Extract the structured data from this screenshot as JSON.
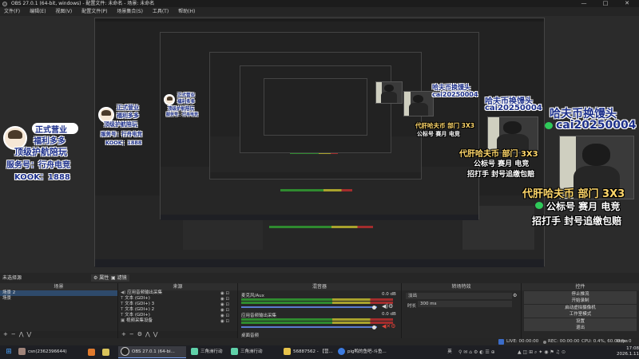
{
  "window": {
    "title": "OBS 27.0.1 (64-bit, windows) - 配置文件: 未命名 - 场景: 未命名",
    "controls": [
      "—",
      "□",
      "✕"
    ]
  },
  "menu": [
    "文件(F)",
    "编辑(E)",
    "视图(V)",
    "配置文件(P)",
    "场景集合(S)",
    "工具(T)",
    "帮助(H)"
  ],
  "overlay": {
    "large": {
      "line1": "哈夫币换馒头",
      "line2": "cai20250004",
      "line3": "代肝哈夫币 部门 3X3",
      "line4": "公标号 赛月 电竞",
      "line5": "招打手 封号追缴包赔"
    },
    "left_badge": {
      "line1": "正式营业",
      "line2": "福利多多",
      "line3": "顶级护航陪玩",
      "line4": "服务号：行舟电竞",
      "line5": "KOOK：1888"
    }
  },
  "dock_header": {
    "left": "未选择源",
    "prop_button": "属性",
    "filter_button": "滤镜"
  },
  "scenes": {
    "title": "场景",
    "items": [
      "场景 2",
      "场景"
    ]
  },
  "sources": {
    "title": "来源",
    "items": [
      "应用音频输出采集",
      "文本 (GDI+)",
      "文本 (GDI+) 3",
      "文本 (GDI+) 2",
      "文本 (GDI+)",
      "视频采集设备"
    ]
  },
  "mixer": {
    "title": "混音器",
    "ch1": {
      "name": "麦克风/Aux",
      "db": "0.0 dB"
    },
    "ch2": {
      "name": "应用音频输出采集",
      "db": "0.0 dB"
    },
    "ch3": {
      "name": "桌面音频"
    }
  },
  "transitions": {
    "title": "转场特效",
    "type": "淡出",
    "duration_label": "时长",
    "duration_value": "300 ms"
  },
  "controls": {
    "title": "控件",
    "buttons": [
      "停止推流",
      "开始录制",
      "启动虚拟摄像机",
      "工作室模式",
      "设置",
      "退出"
    ]
  },
  "status": {
    "live": "LIVE: 00:00:00",
    "rec": "REC: 00:00:00",
    "cpu": "CPU: 0.4%, 60.00 fps",
    "kbps": "kb/s: 0"
  },
  "taskbar": {
    "items": [
      "csn(2362396644)",
      "OBS 27.0.1 (64-bi...",
      "三角洲行动",
      "三角洲行动",
      "56887562 - 【营...",
      "pig鸭的鱼吧-斗鱼..."
    ],
    "tray": "英",
    "time": "17:08",
    "date": "2026.1.11"
  },
  "colors": {
    "accent": "#2e4a6b",
    "wechat_green": "#2fc95a",
    "text_yellow": "#ffd76a",
    "meter_green": "#2f8a2f",
    "meter_yellow": "#a9a22d",
    "meter_red": "#a32d2d"
  }
}
